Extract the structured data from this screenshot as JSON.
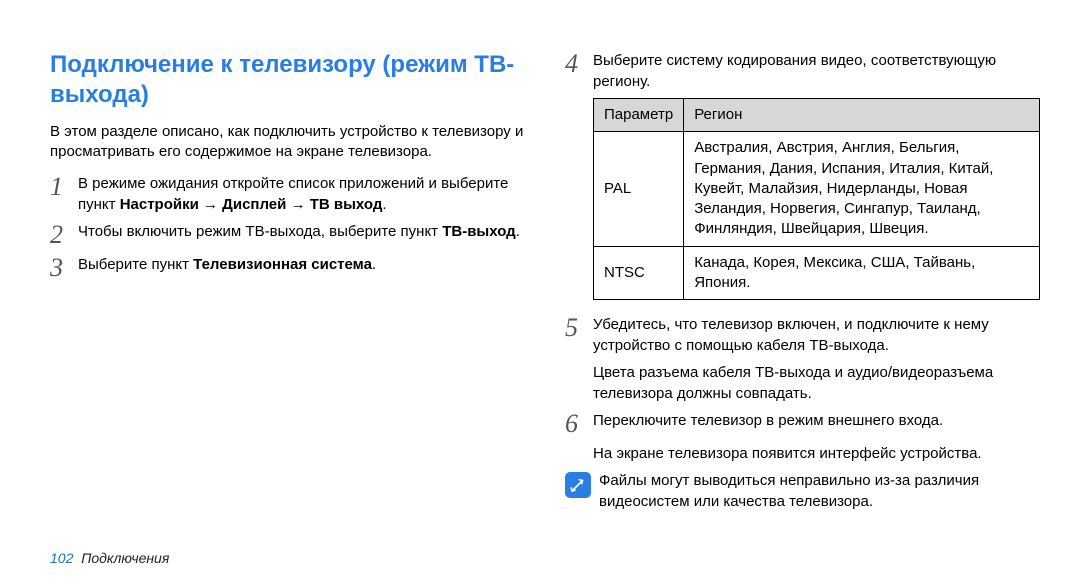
{
  "heading": "Подключение к телевизору (режим ТВ-выхода)",
  "intro": "В этом разделе описано, как подключить устройство к телевизору и просматривать его содержимое на экране телевизора.",
  "steps_left": {
    "s1_pre": "В режиме ожидания откройте список приложений и выберите пункт ",
    "s1_b": "Настройки → Дисплей → ТВ выход",
    "s1_post": ".",
    "s2_pre": "Чтобы включить режим ТВ-выхода, выберите пункт ",
    "s2_b": "ТВ-выход",
    "s2_post": ".",
    "s3_pre": "Выберите пункт ",
    "s3_b": "Телевизионная система",
    "s3_post": "."
  },
  "steps_right": {
    "s4": "Выберите систему кодирования видео, соответствующую региону.",
    "s5": "Убедитесь, что телевизор включен, и подключите к нему устройство с помощью кабеля ТВ-выхода.",
    "s5b": "Цвета разъема кабеля ТВ-выхода и аудио/видеоразъема телевизора должны совпадать.",
    "s6": "Переключите телевизор в режим внешнего входа.",
    "s6b": "На экране телевизора появится интерфейс устройства."
  },
  "table": {
    "h1": "Параметр",
    "h2": "Регион",
    "r1c1": "PAL",
    "r1c2": "Австралия, Австрия, Англия, Бельгия, Германия, Дания, Испания, Италия, Китай, Кувейт, Малайзия, Нидерланды, Новая Зеландия, Норвегия, Сингапур, Таиланд, Финляндия, Швейцария, Швеция.",
    "r2c1": "NTSC",
    "r2c2": "Канада, Корея, Мексика, США, Тайвань, Япония."
  },
  "note": "Файлы могут выводиться неправильно из-за различия видеосистем или качества телевизора.",
  "footer": {
    "page": "102",
    "section": "Подключения"
  }
}
